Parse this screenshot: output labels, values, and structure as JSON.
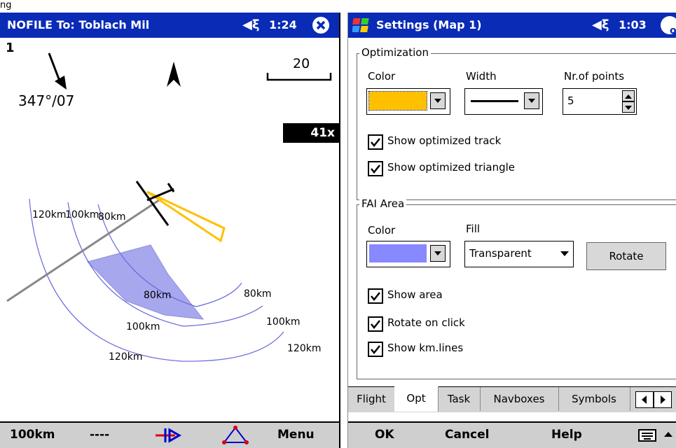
{
  "header_text": "ng",
  "map_screen": {
    "title": "NOFILE  To: Toblach Mil",
    "time": "1:24",
    "speaker_icon": "speaker-icon",
    "close_icon": "close-icon",
    "index": "1",
    "wind": "347°/07",
    "scale": "20",
    "zoom": "41x",
    "arc_labels_left": [
      "120km",
      "100km",
      "80km"
    ],
    "arc_labels_right": [
      "80km",
      "80km",
      "100km",
      "100km",
      "120km",
      "120km"
    ],
    "bottom": {
      "distance": "100km",
      "value": "----",
      "menu": "Menu"
    },
    "colors": {
      "title_bar": "#0a2bb5",
      "fai_area": "#9999ee",
      "triangle": "#ffc000",
      "arcs": "#6666dd"
    }
  },
  "settings": {
    "title": "Settings (Map 1)",
    "time": "1:03",
    "ok_badge": "ok",
    "optimization": {
      "label": "Optimization",
      "color_label": "Color",
      "width_label": "Width",
      "points_label": "Nr.of points",
      "points_value": "5",
      "color_value": "#ffc000",
      "show_track": "Show optimized track",
      "show_triangle": "Show optimized triangle",
      "show_track_checked": true,
      "show_triangle_checked": true
    },
    "fai_area": {
      "label": "FAI Area",
      "color_label": "Color",
      "fill_label": "Fill",
      "fill_value": "Transparent",
      "rotate_label": "Rotate",
      "color_value": "#8888ff",
      "show_area": "Show area",
      "rotate_on_click": "Rotate on click",
      "show_km_lines": "Show km.lines"
    },
    "tabs": [
      "Flight",
      "Opt",
      "Task",
      "Navboxes",
      "Symbols"
    ],
    "active_tab": "Opt",
    "softkeys": {
      "ok": "OK",
      "cancel": "Cancel",
      "help": "Help"
    }
  }
}
